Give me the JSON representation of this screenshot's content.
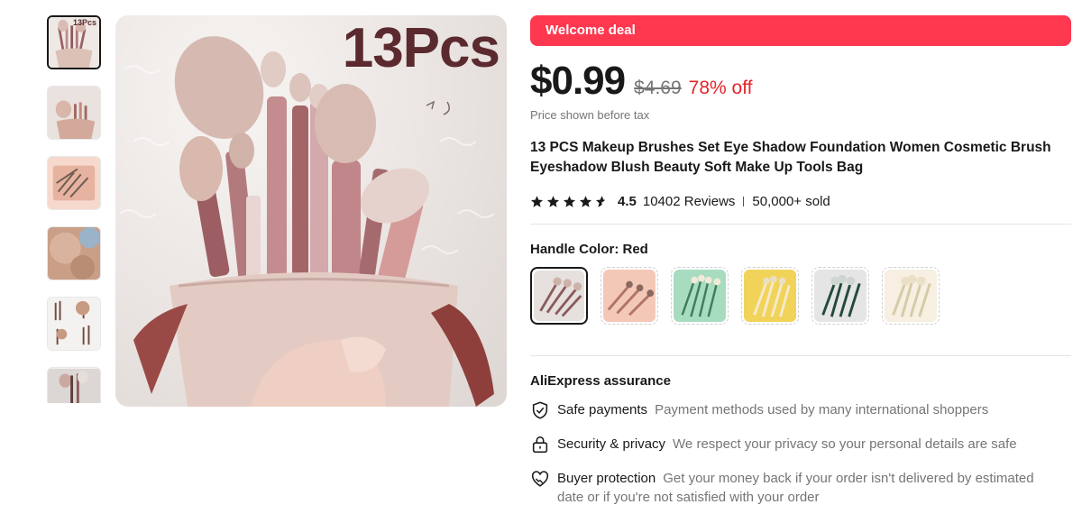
{
  "gallery": {
    "thumbnails": [
      {
        "id": "thumb-1",
        "badge": "13Pcs",
        "colors": [
          "#efe9e6",
          "#c9a7a1",
          "#8e5a5c"
        ]
      },
      {
        "id": "thumb-2",
        "colors": [
          "#e9e2df",
          "#d8b7a8",
          "#a3695f"
        ]
      },
      {
        "id": "thumb-3",
        "colors": [
          "#f6d9cc",
          "#e6b3a0",
          "#6d5a52"
        ]
      },
      {
        "id": "thumb-4",
        "colors": [
          "#d9b39d",
          "#c99f87",
          "#9ab3c8"
        ]
      },
      {
        "id": "thumb-5",
        "colors": [
          "#f4f2f0",
          "#6e4b40",
          "#c79b82"
        ]
      },
      {
        "id": "thumb-6",
        "colors": [
          "#dcd7d4",
          "#caa99f",
          "#5e3f3c"
        ]
      }
    ],
    "main_badge": "13Pcs"
  },
  "deal": {
    "label": "Welcome deal",
    "color": "#fd384f"
  },
  "pricing": {
    "price": "$0.99",
    "original_price": "$4.69",
    "discount": "78% off",
    "tax_note": "Price shown before tax"
  },
  "product": {
    "title": "13 PCS Makeup Brushes Set Eye Shadow Foundation Women Cosmetic Brush Eyeshadow Blush Beauty Soft Make Up Tools Bag"
  },
  "rating": {
    "score_value": 4.5,
    "score": "4.5",
    "reviews": "10402 Reviews",
    "sold": "50,000+ sold"
  },
  "variants": {
    "label": "Handle Color: Red",
    "selected_index": 0,
    "options": [
      {
        "name": "Red",
        "bg": "#e6e1de",
        "accent": "#8b5a5b"
      },
      {
        "name": "Pink",
        "bg": "#f4c8b7",
        "accent": "#b07566"
      },
      {
        "name": "Green",
        "bg": "#a8dcc0",
        "accent": "#3f7c5c"
      },
      {
        "name": "Yellow",
        "bg": "#f2d35a",
        "accent": "#f4eacd"
      },
      {
        "name": "Dark Green",
        "bg": "#e5e5e5",
        "accent": "#234a3a"
      },
      {
        "name": "Beige",
        "bg": "#f6efe2",
        "accent": "#d8c9a6"
      }
    ]
  },
  "assurance": {
    "title": "AliExpress assurance",
    "items": [
      {
        "icon": "shield-check-icon",
        "label": "Safe payments",
        "text": "Payment methods used by many international shoppers"
      },
      {
        "icon": "lock-icon",
        "label": "Security & privacy",
        "text": "We respect your privacy so your personal details are safe"
      },
      {
        "icon": "handshake-heart-icon",
        "label": "Buyer protection",
        "text": "Get your money back if your order isn't delivered by estimated date or if you're not satisfied with your order"
      }
    ]
  }
}
